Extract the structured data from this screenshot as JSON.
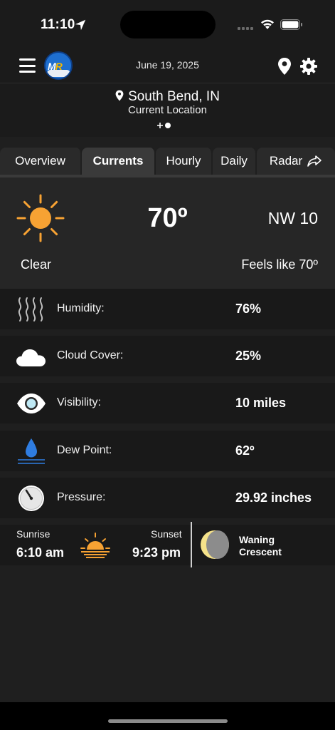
{
  "status_bar": {
    "time": "11:10"
  },
  "header": {
    "date": "June 19, 2025",
    "logo_text_m": "M",
    "logo_text_r": "R"
  },
  "location": {
    "name": "South Bend, IN",
    "subtitle": "Current Location"
  },
  "tabs": [
    {
      "label": "Overview",
      "active": false
    },
    {
      "label": "Currents",
      "active": true
    },
    {
      "label": "Hourly",
      "active": false
    },
    {
      "label": "Daily",
      "active": false
    },
    {
      "label": "Radar",
      "active": false
    }
  ],
  "current": {
    "temperature": "70º",
    "wind": "NW 10",
    "condition": "Clear",
    "feels_like": "Feels like 70º",
    "icon": "sun-icon"
  },
  "details": [
    {
      "label": "Humidity:",
      "value": "76%",
      "icon": "humidity-icon"
    },
    {
      "label": "Cloud Cover:",
      "value": "25%",
      "icon": "cloud-icon"
    },
    {
      "label": "Visibility:",
      "value": "10 miles",
      "icon": "eye-icon"
    },
    {
      "label": "Dew Point:",
      "value": "62º",
      "icon": "water-drop-icon"
    },
    {
      "label": "Pressure:",
      "value": "29.92 inches",
      "icon": "gauge-icon"
    }
  ],
  "sun": {
    "sunrise_label": "Sunrise",
    "sunrise_time": "6:10 am",
    "sunset_label": "Sunset",
    "sunset_time": "9:23 pm"
  },
  "moon": {
    "phase_line1": "Waning",
    "phase_line2": "Crescent"
  },
  "colors": {
    "background": "#1f1f1f",
    "accent_sun": "#f7a233",
    "drop_blue": "#2f7de1",
    "tab_active": "#3a3a3a",
    "tab_inactive": "#2a2a2a"
  }
}
